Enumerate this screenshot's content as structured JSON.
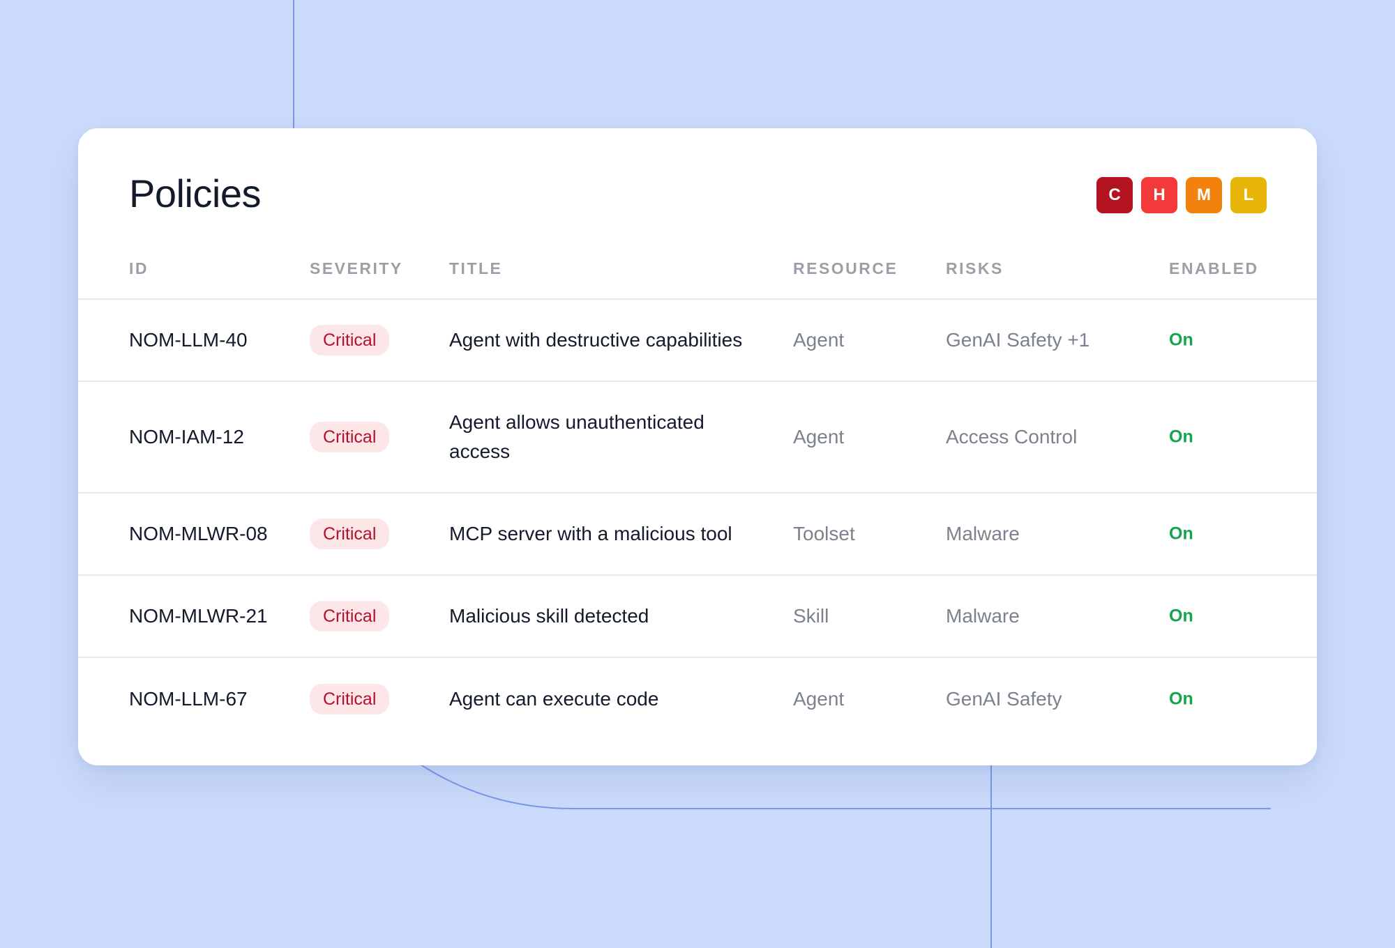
{
  "page": {
    "title": "Policies"
  },
  "severity_legend": [
    {
      "letter": "C",
      "color": "#b3121f"
    },
    {
      "letter": "H",
      "color": "#f3393a"
    },
    {
      "letter": "M",
      "color": "#f2820d"
    },
    {
      "letter": "L",
      "color": "#e6b507"
    }
  ],
  "table": {
    "columns": [
      "ID",
      "SEVERITY",
      "TITLE",
      "RESOURCE",
      "RISKS",
      "ENABLED"
    ],
    "rows": [
      {
        "id": "NOM-LLM-40",
        "severity": "Critical",
        "title": "Agent with destructive capabilities",
        "resource": "Agent",
        "risks": "GenAI Safety +1",
        "enabled": "On"
      },
      {
        "id": "NOM-IAM-12",
        "severity": "Critical",
        "title": "Agent allows unauthenticated access",
        "resource": "Agent",
        "risks": "Access Control",
        "enabled": "On"
      },
      {
        "id": "NOM-MLWR-08",
        "severity": "Critical",
        "title": "MCP server with a malicious tool",
        "resource": "Toolset",
        "risks": "Malware",
        "enabled": "On"
      },
      {
        "id": "NOM-MLWR-21",
        "severity": "Critical",
        "title": "Malicious skill detected",
        "resource": "Skill",
        "risks": "Malware",
        "enabled": "On"
      },
      {
        "id": "NOM-LLM-67",
        "severity": "Critical",
        "title": "Agent can execute code",
        "resource": "Agent",
        "risks": "GenAI Safety",
        "enabled": "On"
      }
    ]
  },
  "colors": {
    "background": "#cddcfc",
    "enabled_on": "#14a44d",
    "critical_text": "#b1122d",
    "critical_bg": "#fde6e8"
  }
}
